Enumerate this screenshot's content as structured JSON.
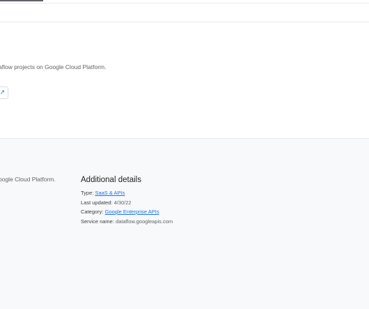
{
  "header": {
    "active_tab": ""
  },
  "overview": {
    "description": "aflow projects on Google Cloud Platform.",
    "launch_icon": "external-link-icon"
  },
  "footer": {
    "overview_text": "oogle Cloud Platform.",
    "details_title": "Additional details",
    "type_label": "Type:",
    "type_value": "SaaS & APIs",
    "updated_label": "Last updated:",
    "updated_value": "4/30/22",
    "category_label": "Category:",
    "category_value": "Google Enterprise APIs",
    "service_label": "Service name:",
    "service_value": "dataflow.googleapis.com"
  },
  "colors": {
    "link": "#1a73e8",
    "footer_bg": "#f8f9fa"
  }
}
